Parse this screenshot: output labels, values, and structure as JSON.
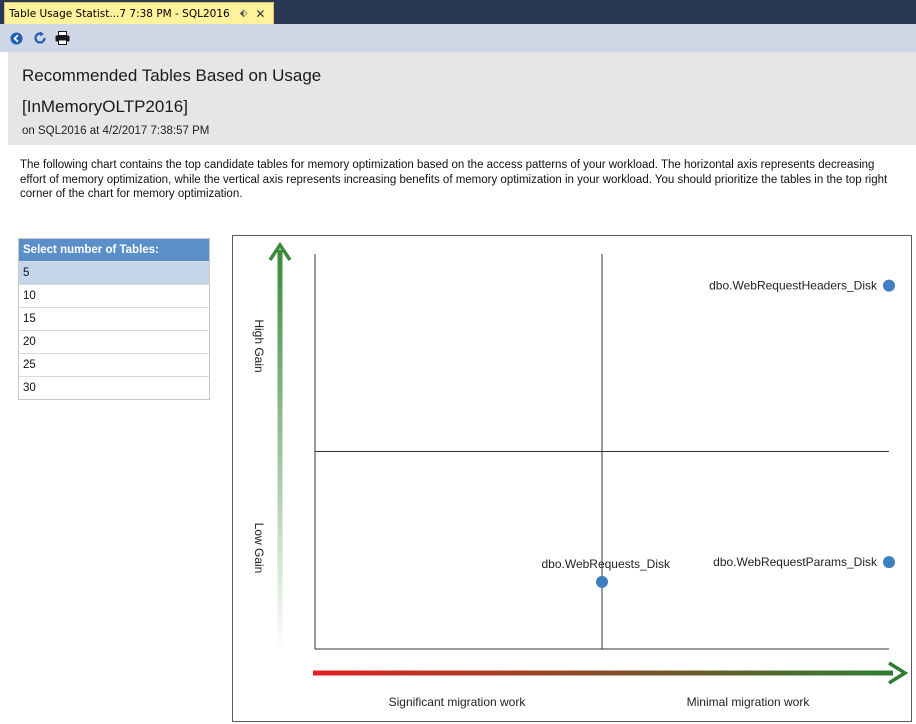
{
  "tab": {
    "title": "Table Usage Statist...7 7:38 PM - SQL2016",
    "pin_icon": "pin-icon",
    "close_icon": "close-icon"
  },
  "toolbar": {
    "buttons": [
      {
        "icon": "back-icon",
        "color": "#1f5fb4"
      },
      {
        "icon": "refresh-icon",
        "color": "#1f5fb4"
      },
      {
        "icon": "print-icon",
        "color": "#1a1a1a"
      }
    ]
  },
  "report": {
    "title": "Recommended Tables Based on Usage",
    "database": "[InMemoryOLTP2016]",
    "subtitle": "on SQL2016 at 4/2/2017 7:38:57 PM",
    "description": "The following chart contains the top candidate tables for memory optimization based on the access patterns of your workload. The horizontal axis represents decreasing effort of memory optimization, while the vertical axis represents increasing benefits of memory optimization in your workload. You should prioritize the tables in the top right corner of the chart for memory optimization."
  },
  "selector": {
    "header": "Select number of Tables:",
    "options": [
      "5",
      "10",
      "15",
      "20",
      "25",
      "30"
    ],
    "selected": "5",
    "header_color": "#5b8fc9",
    "selected_color": "#c5d5ea"
  },
  "chart_data": {
    "type": "scatter",
    "title": "",
    "xlabel_left": "Significant migration work",
    "xlabel_right": "Minimal migration work",
    "ylabel_top": "High Gain",
    "ylabel_bottom": "Low Gain",
    "xlim": [
      0,
      2
    ],
    "ylim": [
      0,
      2
    ],
    "grid": false,
    "quadrant_lines": {
      "x": 1,
      "y": 1
    },
    "point_color": "#3d7fc1",
    "x_arrow_colors": [
      "#e02020",
      "#2e7d32"
    ],
    "y_arrow_colors": [
      "#ffffff",
      "#3a8a3a"
    ],
    "points": [
      {
        "label": "dbo.WebRequestHeaders_Disk",
        "x": 2.0,
        "y": 1.84
      },
      {
        "label": "dbo.WebRequestParams_Disk",
        "x": 2.0,
        "y": 0.44
      },
      {
        "label": "dbo.WebRequests_Disk",
        "x": 1.0,
        "y": 0.34
      }
    ]
  }
}
